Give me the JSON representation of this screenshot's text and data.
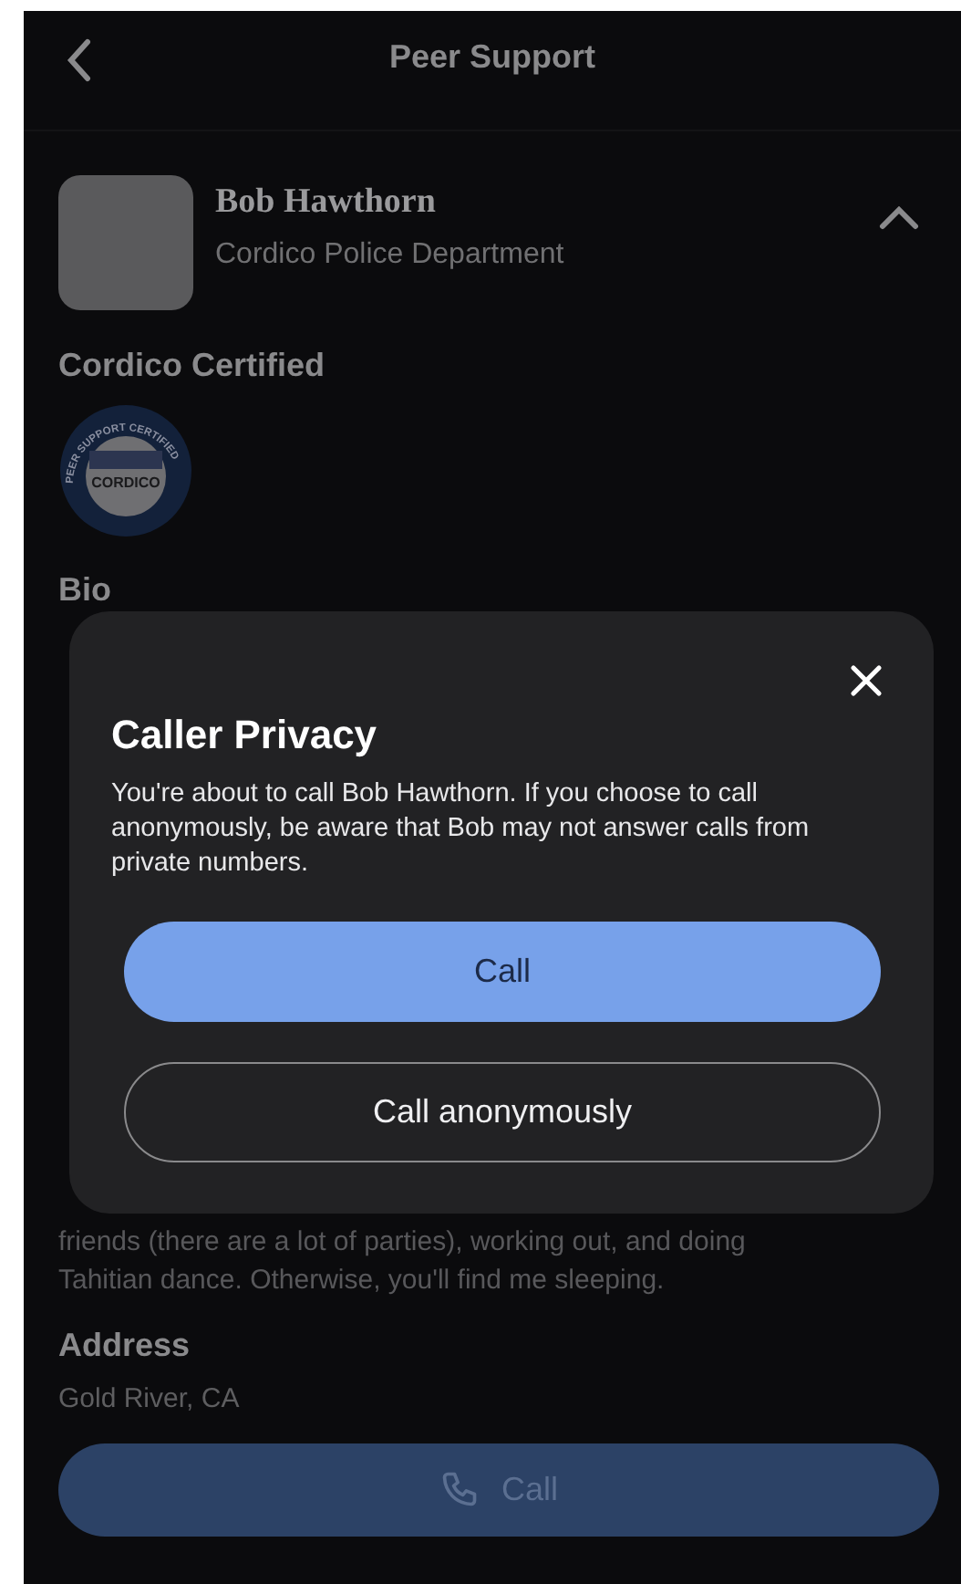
{
  "header": {
    "title": "Peer Support"
  },
  "profile": {
    "name": "Bob Hawthorn",
    "department": "Cordico Police Department",
    "expanded": true
  },
  "certification": {
    "heading": "Cordico Certified",
    "badge": {
      "ring_text": "PEER SUPPORT CERTIFIED",
      "name": "CORDICO"
    }
  },
  "bio": {
    "heading": "Bio",
    "lines": [
      "friends (there are a lot of parties), working out, and doing",
      "Tahitian dance. Otherwise, you'll find me sleeping."
    ]
  },
  "address": {
    "heading": "Address",
    "value": "Gold River, CA"
  },
  "call_button": {
    "label": "Call"
  },
  "dialog": {
    "title": "Caller Privacy",
    "message": "You're about to call Bob Hawthorn. If you choose to call anonymously, be aware that Bob may not answer calls from private numbers.",
    "buttons": [
      {
        "label": "Call",
        "kind": "primary"
      },
      {
        "label": "Call anonymously",
        "kind": "outline"
      }
    ]
  }
}
